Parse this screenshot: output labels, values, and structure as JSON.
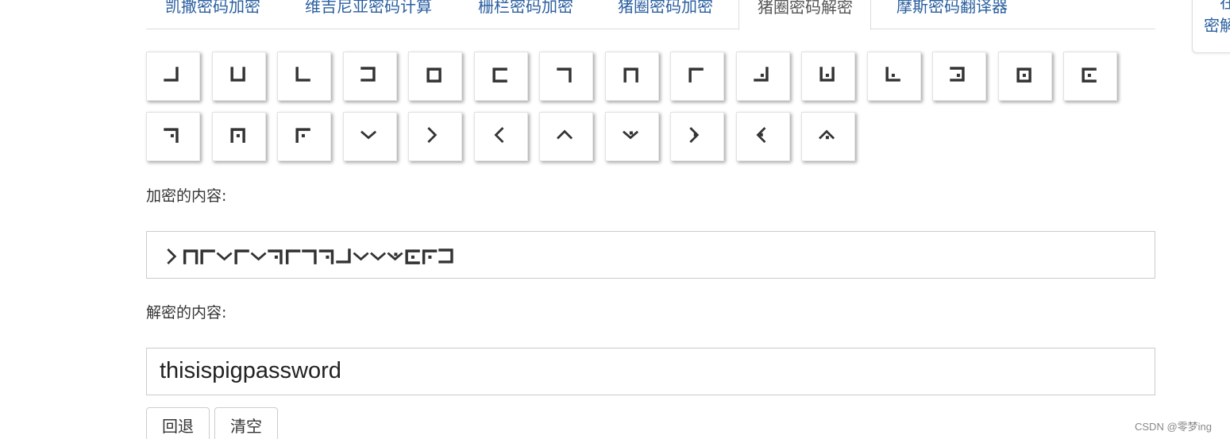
{
  "tabs": [
    {
      "label": "凯撒密码加密",
      "active": false
    },
    {
      "label": "维吉尼亚密码计算",
      "active": false
    },
    {
      "label": "栅栏密码加密",
      "active": false
    },
    {
      "label": "猪圈密码加密",
      "active": false
    },
    {
      "label": "猪圈密码解密",
      "active": true
    },
    {
      "label": "摩斯密码翻译器",
      "active": false
    }
  ],
  "side_widget": {
    "line1": "在",
    "line2": "密解"
  },
  "symbols": {
    "row1": [
      "J",
      "U",
      "L",
      "3",
      "O",
      "C",
      "7",
      "N",
      "F",
      "Jd",
      "Ud",
      "Ld",
      "3d",
      "Od",
      "Cd"
    ],
    "row2": [
      "7d",
      "Nd",
      "Fd",
      "v",
      "gt",
      "lt",
      "caret",
      "vd",
      "gtd",
      "ltd",
      "caretd"
    ]
  },
  "encrypted_label": "加密的内容:",
  "encrypted_symbols": [
    "gt",
    "N",
    "F",
    "v",
    "F",
    "v",
    "7d",
    "F",
    "7",
    "7d",
    "J",
    "v",
    "v",
    "vd",
    "Cd",
    "Fd",
    "3"
  ],
  "decrypted_label": "解密的内容:",
  "decrypted_value": "thisispigpassword",
  "buttons": {
    "back": "回退",
    "clear": "清空"
  },
  "watermark": "CSDN @零梦ing",
  "colors": {
    "tab_link": "#2a5fa0",
    "symbol": "#333333"
  }
}
